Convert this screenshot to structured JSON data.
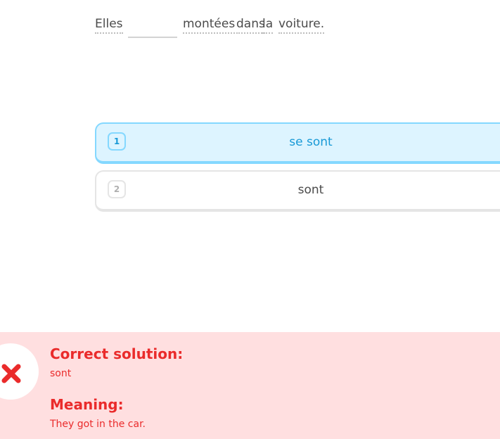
{
  "sentence": {
    "words": [
      "Elles",
      "montées",
      "dans",
      "la",
      "voiture."
    ]
  },
  "choices": [
    {
      "number": "1",
      "text": "se sont",
      "selected": true
    },
    {
      "number": "2",
      "text": "sont",
      "selected": false
    }
  ],
  "feedback": {
    "status": "incorrect",
    "solution_heading": "Correct solution:",
    "solution_text": "sont",
    "meaning_heading": "Meaning:",
    "meaning_text": "They got in the car.",
    "icon": "close-icon"
  },
  "colors": {
    "selected_bg": "#ddf4ff",
    "selected_border": "#84d8ff",
    "selected_text": "#1899d6",
    "error_red": "#ea2b2b",
    "error_bg": "#ffdfe0"
  }
}
